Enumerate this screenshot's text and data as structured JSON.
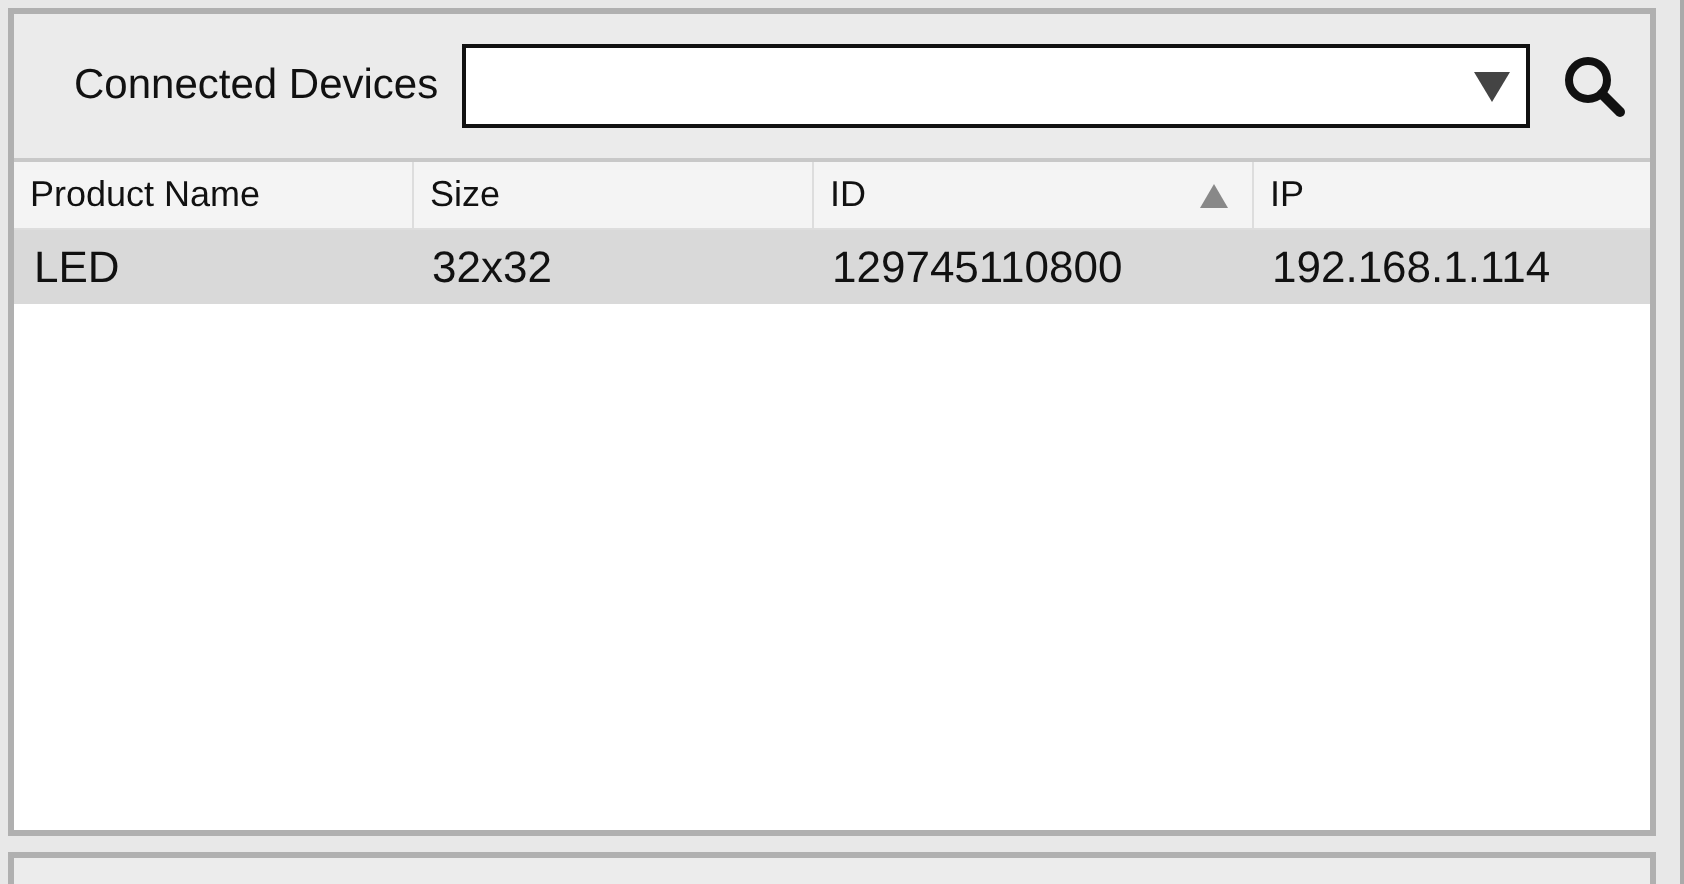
{
  "toolbar": {
    "label": "Connected Devices"
  },
  "table": {
    "columns": [
      {
        "label": "Product Name",
        "sorted": false
      },
      {
        "label": "Size",
        "sorted": false
      },
      {
        "label": "ID",
        "sorted": true
      },
      {
        "label": "IP",
        "sorted": false
      }
    ],
    "rows": [
      {
        "cells": [
          "LED",
          "32x32",
          "129745110800",
          "192.168.1.114"
        ],
        "selected": true
      }
    ]
  }
}
